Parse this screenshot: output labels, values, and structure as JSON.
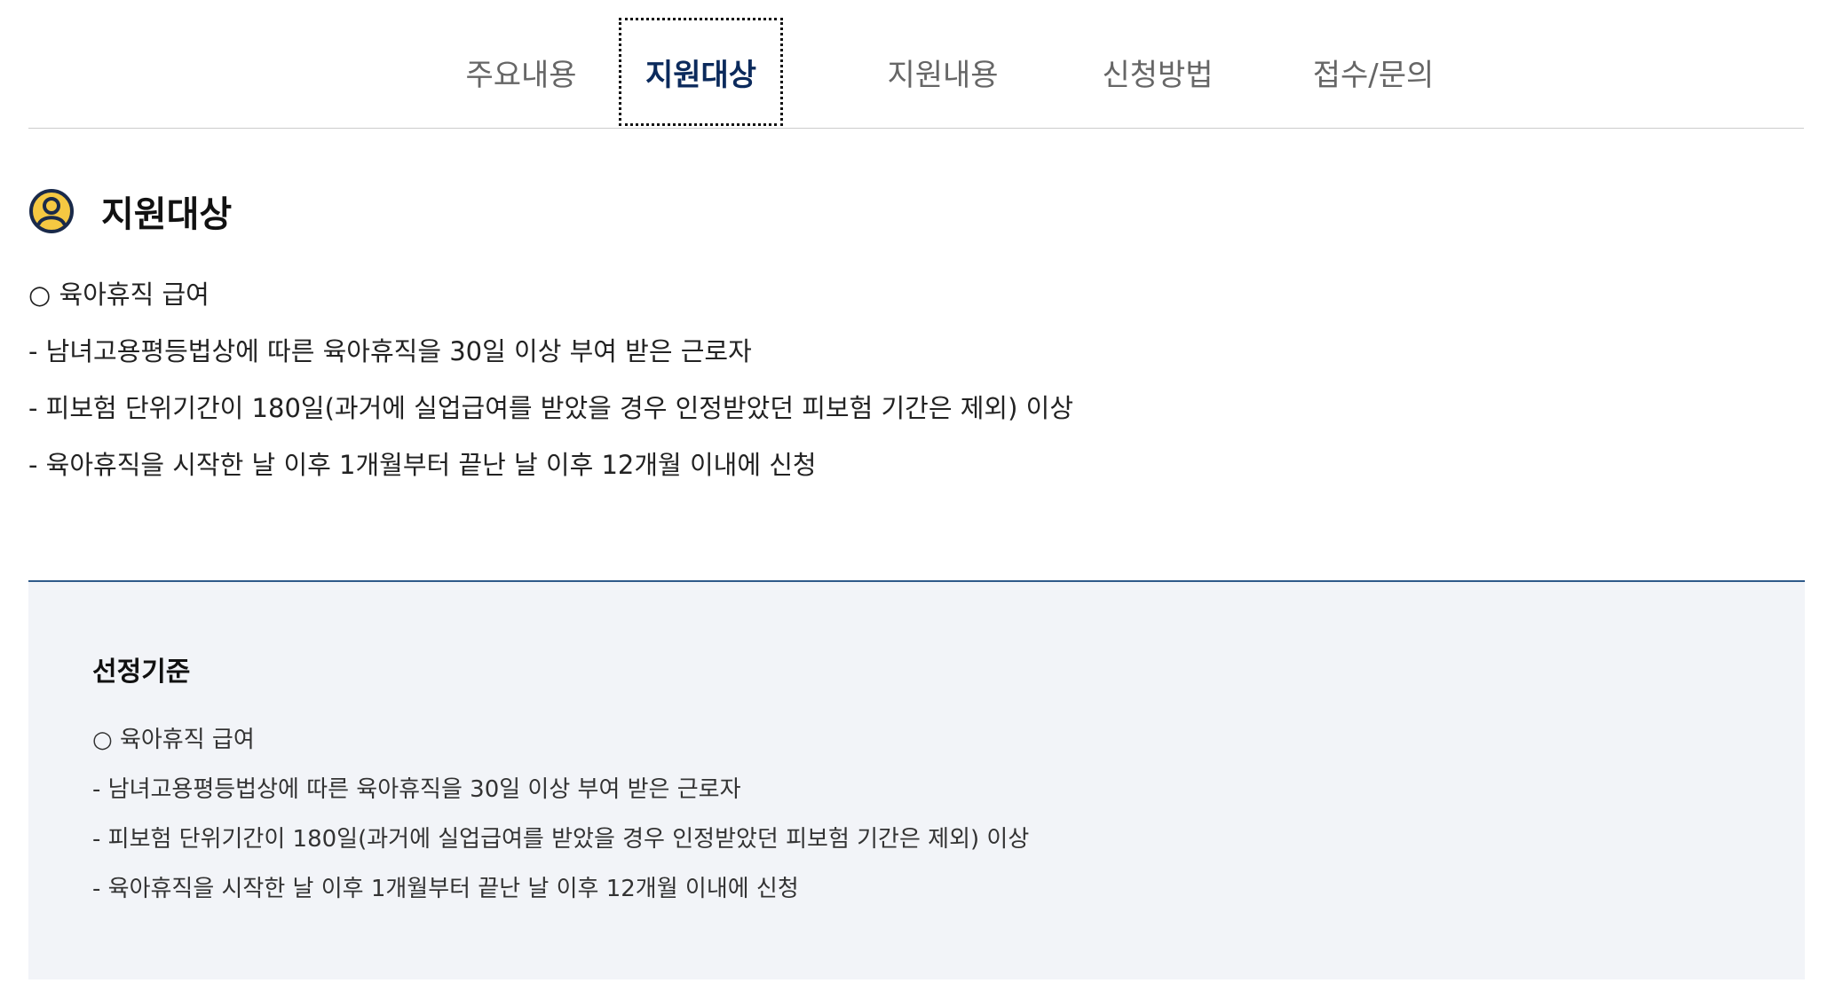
{
  "tabs": [
    {
      "label": "주요내용"
    },
    {
      "label": "지원대상"
    },
    {
      "label": "지원내용"
    },
    {
      "label": "신청방법"
    },
    {
      "label": "접수/문의"
    }
  ],
  "active_tab": "지원대상",
  "section": {
    "title": "지원대상",
    "icon": "user-circle-icon",
    "lines": [
      "○ 육아휴직 급여",
      "- 남녀고용평등법상에 따른 육아휴직을 30일 이상 부여 받은 근로자",
      "- 피보험 단위기간이 180일(과거에 실업급여를 받았을 경우 인정받았던 피보험 기간은 제외) 이상",
      "- 육아휴직을 시작한 날 이후 1개월부터 끝난 날 이후 12개월 이내에 신청"
    ]
  },
  "criteria": {
    "title": "선정기준",
    "lines": [
      "○ 육아휴직 급여",
      "- 남녀고용평등법상에 따른 육아휴직을 30일 이상 부여 받은 근로자",
      "- 피보험 단위기간이 180일(과거에 실업급여를 받았을 경우 인정받았던 피보험 기간은 제외) 이상",
      "- 육아휴직을 시작한 날 이후 1개월부터 끝난 날 이후 12개월 이내에 신청"
    ]
  },
  "colors": {
    "active_tab_text": "#0b2a5c",
    "icon_fill": "#f5c842",
    "icon_stroke": "#1a2a4a",
    "criteria_bg": "#f2f4f8",
    "criteria_border": "#2f5a8a"
  }
}
